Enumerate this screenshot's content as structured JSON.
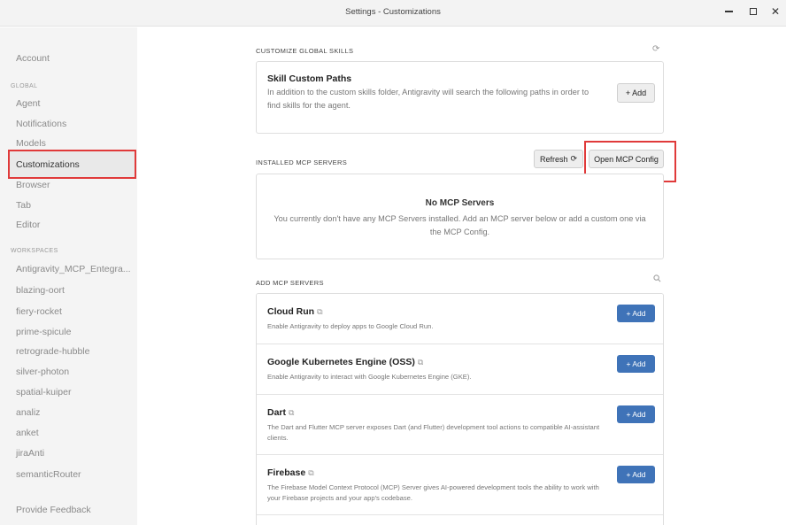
{
  "window": {
    "title": "Settings - Customizations"
  },
  "sidebar": {
    "account": "Account",
    "global_heading": "GLOBAL",
    "global_items": [
      "Agent",
      "Notifications",
      "Models",
      "Customizations",
      "Browser",
      "Tab",
      "Editor"
    ],
    "workspaces_heading": "WORKSPACES",
    "workspace_items": [
      "Antigravity_MCP_Entegra...",
      "blazing-oort",
      "fiery-rocket",
      "prime-spicule",
      "retrograde-hubble",
      "silver-photon",
      "spatial-kuiper",
      "analiz",
      "anket",
      "jiraAnti",
      "semanticRouter"
    ],
    "feedback": "Provide Feedback",
    "active_item": "Customizations"
  },
  "skills": {
    "section_label": "CUSTOMIZE GLOBAL SKILLS",
    "title": "Skill Custom Paths",
    "description": "In addition to the custom skills folder, Antigravity will search the following paths in order to find skills for the agent.",
    "add_label": "+ Add"
  },
  "installed": {
    "section_label": "INSTALLED MCP SERVERS",
    "refresh_label": "Refresh",
    "open_config_label": "Open MCP Config",
    "empty_title": "No MCP Servers",
    "empty_text": "You currently don't have any MCP Servers installed. Add an MCP server below or add a custom one via the MCP Config."
  },
  "add_servers": {
    "section_label": "ADD MCP SERVERS",
    "add_label": "+ Add",
    "items": [
      {
        "name": "Cloud Run",
        "description": "Enable Antigravity to deploy apps to Google Cloud Run."
      },
      {
        "name": "Google Kubernetes Engine (OSS)",
        "description": "Enable Antigravity to interact with Google Kubernetes Engine (GKE)."
      },
      {
        "name": "Dart",
        "description": "The Dart and Flutter MCP server exposes Dart (and Flutter) development tool actions to compatible AI-assistant clients."
      },
      {
        "name": "Firebase",
        "description": "The Firebase Model Context Protocol (MCP) Server gives AI-powered development tools the ability to work with your Firebase projects and your app's codebase."
      }
    ]
  },
  "colors": {
    "accent": "#3f73b8",
    "highlight": "#e03a3a"
  }
}
